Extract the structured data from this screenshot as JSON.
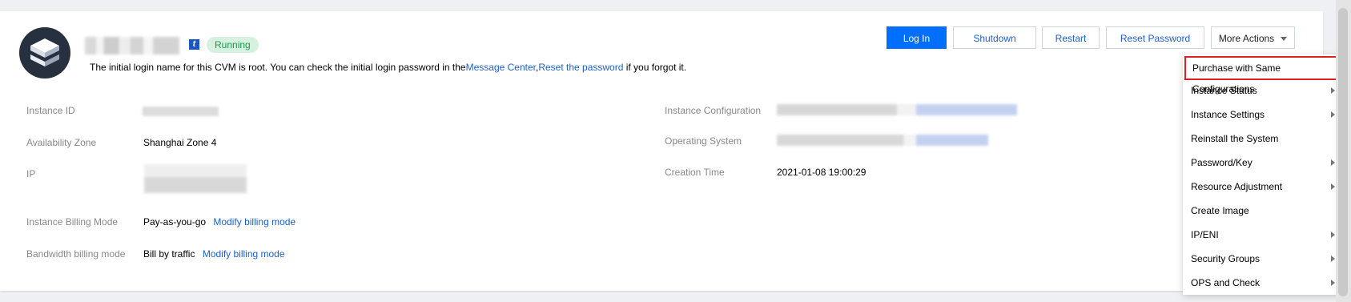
{
  "instance": {
    "status": "Running",
    "notice_text": "The initial login name for this CVM is root. You can check the initial login password in the",
    "notice_link_message_center": "Message Center",
    "notice_sep": ",",
    "notice_link_reset": "Reset the password",
    "notice_suffix": " if you forgot it."
  },
  "actions": {
    "login": "Log In",
    "shutdown": "Shutdown",
    "restart": "Restart",
    "reset_password": "Reset Password",
    "more_actions": "More Actions"
  },
  "details": {
    "instance_id_label": "Instance ID",
    "availability_zone_label": "Availability Zone",
    "availability_zone_value": "Shanghai Zone 4",
    "ip_label": "IP",
    "billing_mode_label": "Instance Billing Mode",
    "billing_mode_value": "Pay-as-you-go",
    "billing_mode_link": "Modify billing mode",
    "bandwidth_label": "Bandwidth billing mode",
    "bandwidth_value": "Bill by traffic",
    "bandwidth_link": "Modify billing mode",
    "instance_config_label": "Instance Configuration",
    "os_label": "Operating System",
    "creation_time_label": "Creation Time",
    "creation_time_value": "2021-01-08 19:00:29"
  },
  "menu": {
    "items": [
      {
        "label": "Purchase with Same Configurations",
        "submenu": false
      },
      {
        "label": "Instance Status",
        "submenu": true
      },
      {
        "label": "Instance Settings",
        "submenu": true
      },
      {
        "label": "Reinstall the System",
        "submenu": false
      },
      {
        "label": "Password/Key",
        "submenu": true
      },
      {
        "label": "Resource Adjustment",
        "submenu": true
      },
      {
        "label": "Create Image",
        "submenu": false
      },
      {
        "label": "IP/ENI",
        "submenu": true
      },
      {
        "label": "Security Groups",
        "submenu": true
      },
      {
        "label": "OPS and Check",
        "submenu": true
      }
    ]
  },
  "colors": {
    "primary": "#006eff",
    "link": "#1e5fc8",
    "status_bg": "#d7f1e1",
    "status_text": "#1f9a4c",
    "highlight_border": "#e02020"
  },
  "icons": {
    "avatar": "cvm-cube-icon",
    "tag": "t-tag-icon",
    "caret": "chevron-down-icon",
    "submenu": "chevron-right-icon"
  }
}
